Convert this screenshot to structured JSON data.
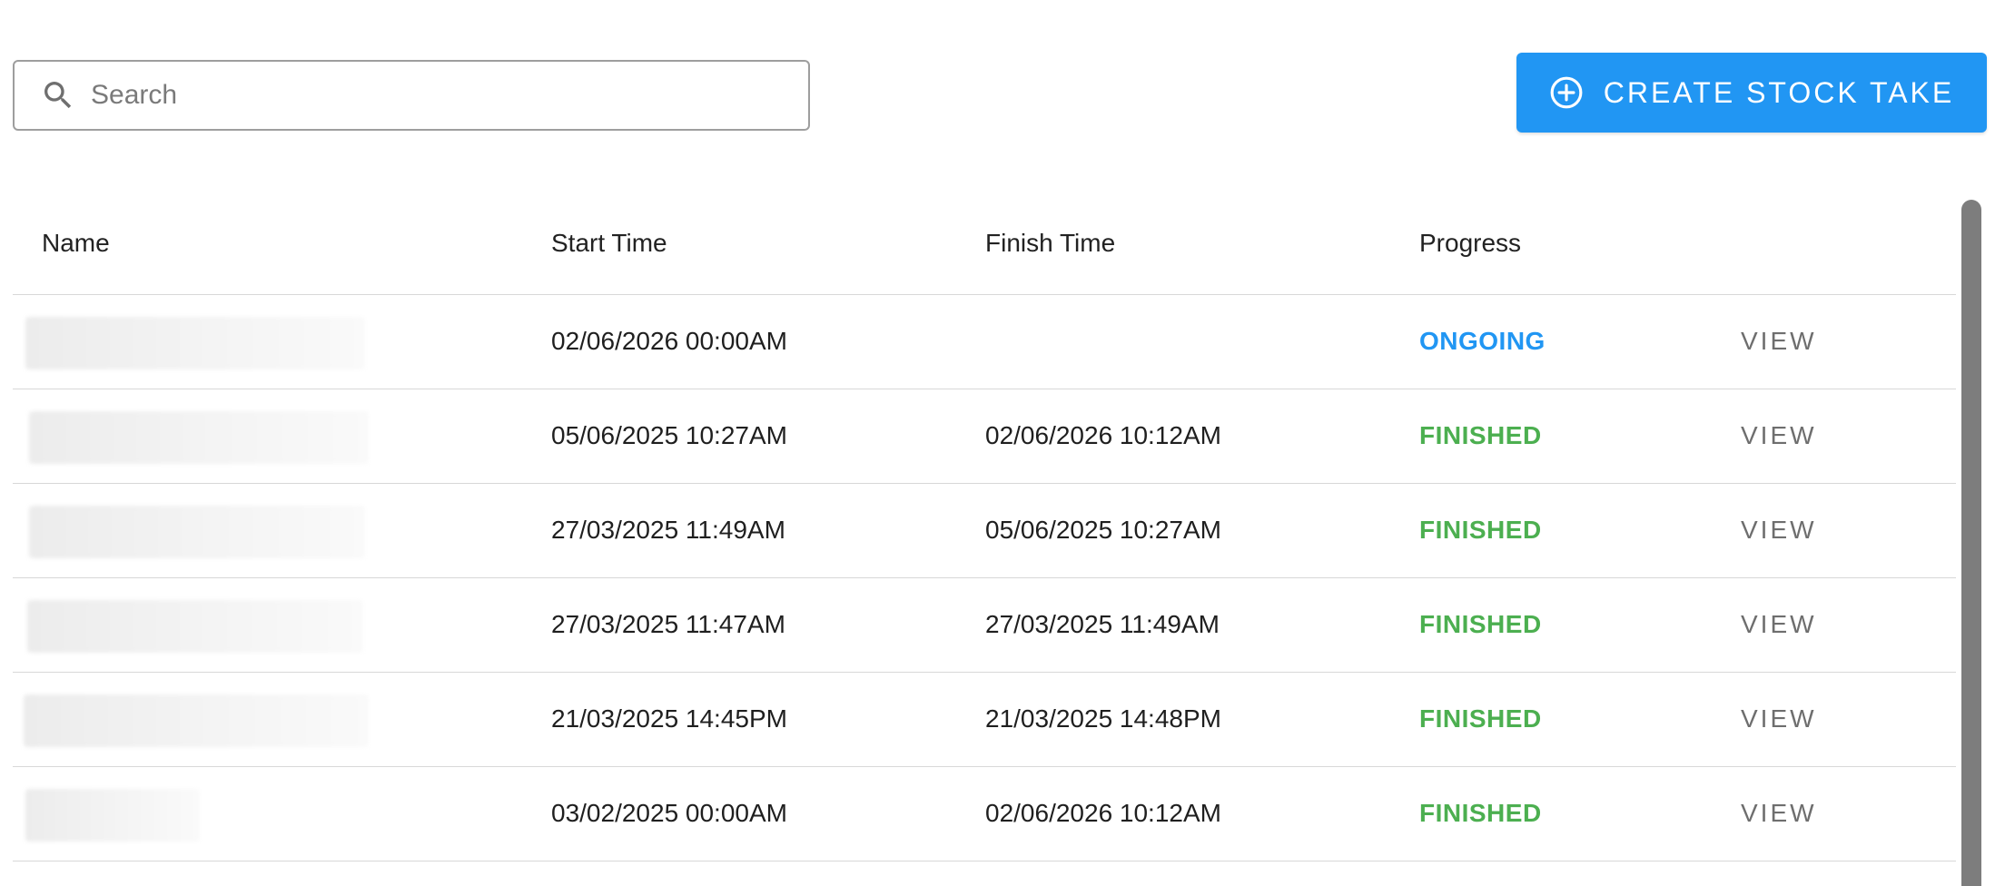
{
  "search": {
    "placeholder": "Search",
    "value": ""
  },
  "toolbar": {
    "create_label": "CREATE STOCK TAKE"
  },
  "colors": {
    "primary": "#2196f3",
    "ongoing": "#2196f3",
    "finished": "#4caf50"
  },
  "table": {
    "headers": {
      "name": "Name",
      "start": "Start Time",
      "finish": "Finish Time",
      "progress": "Progress"
    },
    "rows": [
      {
        "name": "",
        "start": "02/06/2026 00:00AM",
        "finish": "",
        "progress": "ONGOING",
        "action": "VIEW"
      },
      {
        "name": "",
        "start": "05/06/2025 10:27AM",
        "finish": "02/06/2026 10:12AM",
        "progress": "FINISHED",
        "action": "VIEW"
      },
      {
        "name": "",
        "start": "27/03/2025 11:49AM",
        "finish": "05/06/2025 10:27AM",
        "progress": "FINISHED",
        "action": "VIEW"
      },
      {
        "name": "",
        "start": "27/03/2025 11:47AM",
        "finish": "27/03/2025 11:49AM",
        "progress": "FINISHED",
        "action": "VIEW"
      },
      {
        "name": "",
        "start": "21/03/2025 14:45PM",
        "finish": "21/03/2025 14:48PM",
        "progress": "FINISHED",
        "action": "VIEW"
      },
      {
        "name": "",
        "start": "03/02/2025 00:00AM",
        "finish": "02/06/2026 10:12AM",
        "progress": "FINISHED",
        "action": "VIEW"
      }
    ]
  }
}
